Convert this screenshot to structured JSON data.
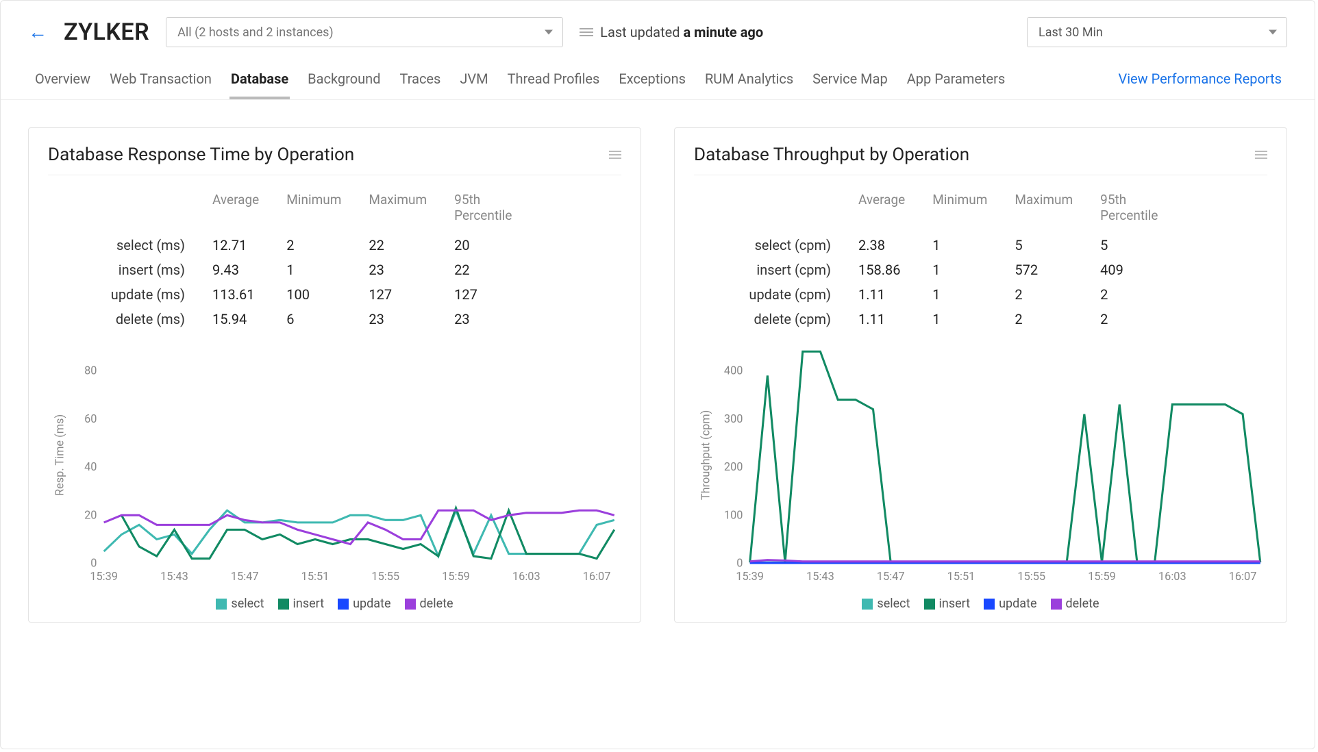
{
  "app_title": "ZYLKER",
  "host_filter": "All (2 hosts and 2 instances)",
  "last_updated_prefix": "Last updated ",
  "last_updated_value": "a minute ago",
  "time_range": "Last 30 Min",
  "tabs": [
    "Overview",
    "Web Transaction",
    "Database",
    "Background",
    "Traces",
    "JVM",
    "Thread Profiles",
    "Exceptions",
    "RUM Analytics",
    "Service Map",
    "App Parameters"
  ],
  "active_tab": "Database",
  "reports_link": "View Performance Reports",
  "series_colors": {
    "select": "#3fb9b1",
    "insert": "#118a63",
    "update": "#1948ff",
    "delete": "#9b3fdc"
  },
  "legend": [
    "select",
    "insert",
    "update",
    "delete"
  ],
  "stat_headers": [
    "Average",
    "Minimum",
    "Maximum",
    "95th Percentile"
  ],
  "panel_left": {
    "title": "Database Response Time by Operation",
    "row_unit": "ms",
    "y_axis_label": "Resp. Time (ms)",
    "rows": [
      {
        "label": "select (ms)",
        "avg": "12.71",
        "min": "2",
        "max": "22",
        "p95": "20"
      },
      {
        "label": "insert (ms)",
        "avg": "9.43",
        "min": "1",
        "max": "23",
        "p95": "22"
      },
      {
        "label": "update (ms)",
        "avg": "113.61",
        "min": "100",
        "max": "127",
        "p95": "127"
      },
      {
        "label": "delete (ms)",
        "avg": "15.94",
        "min": "6",
        "max": "23",
        "p95": "23"
      }
    ]
  },
  "panel_right": {
    "title": "Database Throughput by Operation",
    "row_unit": "cpm",
    "y_axis_label": "Throughput (cpm)",
    "rows": [
      {
        "label": "select (cpm)",
        "avg": "2.38",
        "min": "1",
        "max": "5",
        "p95": "5"
      },
      {
        "label": "insert (cpm)",
        "avg": "158.86",
        "min": "1",
        "max": "572",
        "p95": "409"
      },
      {
        "label": "update (cpm)",
        "avg": "1.11",
        "min": "1",
        "max": "2",
        "p95": "2"
      },
      {
        "label": "delete (cpm)",
        "avg": "1.11",
        "min": "1",
        "max": "2",
        "p95": "2"
      }
    ]
  },
  "chart_data": [
    {
      "type": "line",
      "title": "Database Response Time by Operation",
      "xlabel": "",
      "ylabel": "Resp. Time (ms)",
      "ylim": [
        0,
        90
      ],
      "yticks": [
        0,
        20,
        40,
        60,
        80
      ],
      "x_categories": [
        "15:39",
        "15:40",
        "15:41",
        "15:42",
        "15:43",
        "15:44",
        "15:45",
        "15:46",
        "15:47",
        "15:48",
        "15:49",
        "15:50",
        "15:51",
        "15:52",
        "15:53",
        "15:54",
        "15:55",
        "15:56",
        "15:57",
        "15:58",
        "15:59",
        "16:00",
        "16:01",
        "16:02",
        "16:03",
        "16:04",
        "16:05",
        "16:06",
        "16:07",
        "16:08"
      ],
      "x_tick_labels": [
        "15:39",
        "15:43",
        "15:47",
        "15:51",
        "15:55",
        "15:59",
        "16:03",
        "16:07"
      ],
      "series": [
        {
          "name": "select",
          "values": [
            5,
            12,
            16,
            10,
            12,
            4,
            14,
            22,
            17,
            17,
            18,
            17,
            17,
            17,
            20,
            20,
            18,
            18,
            20,
            3,
            22,
            4,
            20,
            4,
            4,
            4,
            4,
            4,
            16,
            18
          ]
        },
        {
          "name": "insert",
          "values": [
            null,
            20,
            7,
            3,
            14,
            2,
            2,
            14,
            14,
            10,
            12,
            8,
            10,
            8,
            10,
            10,
            8,
            6,
            8,
            3,
            23,
            3,
            2,
            22,
            4,
            4,
            4,
            4,
            2,
            14
          ]
        },
        {
          "name": "update",
          "values": [
            null,
            null,
            null,
            null,
            null,
            null,
            null,
            null,
            null,
            null,
            null,
            null,
            null,
            null,
            null,
            null,
            null,
            null,
            null,
            null,
            null,
            null,
            null,
            null,
            null,
            null,
            null,
            null,
            null,
            null
          ]
        },
        {
          "name": "delete",
          "values": [
            17,
            20,
            20,
            16,
            16,
            16,
            16,
            20,
            18,
            17,
            17,
            14,
            12,
            10,
            8,
            17,
            14,
            10,
            10,
            22,
            22,
            22,
            18,
            20,
            21,
            21,
            21,
            22,
            22,
            20
          ]
        }
      ]
    },
    {
      "type": "line",
      "title": "Database Throughput by Operation",
      "xlabel": "",
      "ylabel": "Throughput (cpm)",
      "ylim": [
        0,
        450
      ],
      "yticks": [
        0,
        100,
        200,
        300,
        400
      ],
      "x_categories": [
        "15:39",
        "15:40",
        "15:41",
        "15:42",
        "15:43",
        "15:44",
        "15:45",
        "15:46",
        "15:47",
        "15:48",
        "15:49",
        "15:50",
        "15:51",
        "15:52",
        "15:53",
        "15:54",
        "15:55",
        "15:56",
        "15:57",
        "15:58",
        "15:59",
        "16:00",
        "16:01",
        "16:02",
        "16:03",
        "16:04",
        "16:05",
        "16:06",
        "16:07",
        "16:08"
      ],
      "x_tick_labels": [
        "15:39",
        "15:43",
        "15:47",
        "15:51",
        "15:55",
        "15:59",
        "16:03",
        "16:07"
      ],
      "series": [
        {
          "name": "select",
          "values": [
            2,
            2,
            2,
            2,
            2,
            2,
            2,
            2,
            2,
            2,
            2,
            2,
            2,
            2,
            2,
            2,
            2,
            2,
            2,
            2,
            2,
            2,
            2,
            2,
            2,
            2,
            2,
            2,
            2,
            2
          ]
        },
        {
          "name": "insert",
          "values": [
            2,
            390,
            2,
            440,
            440,
            340,
            340,
            320,
            2,
            2,
            2,
            2,
            2,
            2,
            2,
            2,
            2,
            2,
            2,
            310,
            2,
            330,
            2,
            2,
            330,
            330,
            330,
            330,
            310,
            2
          ]
        },
        {
          "name": "update",
          "values": [
            1,
            1,
            1,
            1,
            1,
            1,
            1,
            1,
            1,
            1,
            1,
            1,
            1,
            1,
            1,
            1,
            1,
            1,
            1,
            1,
            1,
            1,
            1,
            1,
            1,
            1,
            1,
            1,
            1,
            1
          ]
        },
        {
          "name": "delete",
          "values": [
            4,
            7,
            6,
            4,
            4,
            4,
            4,
            4,
            4,
            4,
            4,
            4,
            4,
            4,
            4,
            4,
            4,
            4,
            4,
            4,
            4,
            4,
            4,
            4,
            4,
            4,
            4,
            4,
            4,
            4
          ]
        }
      ]
    }
  ]
}
